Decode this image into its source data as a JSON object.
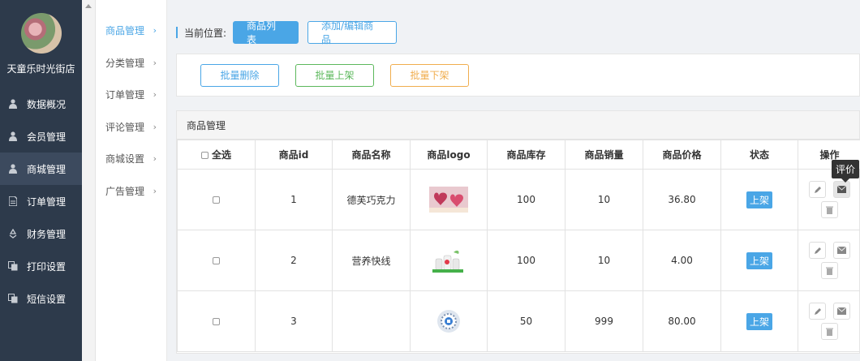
{
  "sidebar": {
    "shop_name": "天童乐时光街店",
    "items": [
      {
        "label": "数据概况",
        "icon": "user-icon",
        "active": false
      },
      {
        "label": "会员管理",
        "icon": "user-icon",
        "active": false
      },
      {
        "label": "商城管理",
        "icon": "user-icon",
        "active": true
      },
      {
        "label": "订单管理",
        "icon": "document-icon",
        "active": false
      },
      {
        "label": "财务管理",
        "icon": "recycle-icon",
        "active": false
      },
      {
        "label": "打印设置",
        "icon": "copy-icon",
        "active": false
      },
      {
        "label": "短信设置",
        "icon": "copy-icon",
        "active": false
      }
    ]
  },
  "submenu": {
    "items": [
      {
        "label": "商品管理",
        "active": true
      },
      {
        "label": "分类管理",
        "active": false
      },
      {
        "label": "订单管理",
        "active": false
      },
      {
        "label": "评论管理",
        "active": false
      },
      {
        "label": "商城设置",
        "active": false
      },
      {
        "label": "广告管理",
        "active": false
      }
    ]
  },
  "breadcrumb": {
    "label": "当前位置:",
    "tab_list": "商品列表",
    "tab_edit": "添加/编辑商品"
  },
  "actions": {
    "batch_delete": "批量删除",
    "batch_on": "批量上架",
    "batch_off": "批量下架"
  },
  "table": {
    "panel_title": "商品管理",
    "select_all": "全选",
    "headers": [
      "商品id",
      "商品名称",
      "商品logo",
      "商品库存",
      "商品销量",
      "商品价格",
      "状态",
      "操作"
    ],
    "rows": [
      {
        "id": "1",
        "name": "德芙巧克力",
        "logo": "chocolate-hearts-image",
        "stock": "100",
        "sales": "10",
        "price": "36.80",
        "status": "上架"
      },
      {
        "id": "2",
        "name": "营养快线",
        "logo": "drink-bottles-image",
        "stock": "100",
        "sales": "10",
        "price": "4.00",
        "status": "上架"
      },
      {
        "id": "3",
        "name": "",
        "logo": "qr-code-image",
        "stock": "50",
        "sales": "999",
        "price": "80.00",
        "status": "上架"
      }
    ]
  },
  "tooltip": "评价",
  "colors": {
    "accent": "#4aa6e6",
    "sidebar_bg": "#2d3a4b",
    "success": "#5cb85c",
    "warning": "#f0ad4e"
  }
}
